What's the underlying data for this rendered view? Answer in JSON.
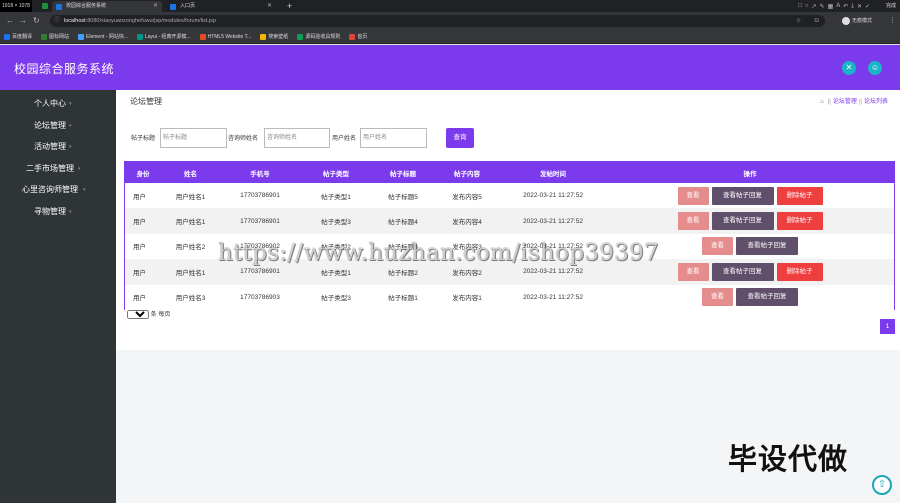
{
  "browser": {
    "window_badge": "1918 × 1078",
    "tabs": [
      {
        "title": "校园综合服务系统",
        "active": true
      },
      {
        "title": "入口页",
        "active": false
      }
    ],
    "new_tab": "+",
    "url_host": "localhost",
    "url_rest": ":8080/xiaoyuanzonghefuwu/jsp/modules/forum/list.jsp",
    "profile_label": "无痕模式",
    "done_label": "完成",
    "bookmarks": [
      "百度翻译",
      "图标网站",
      "Element - 网站快...",
      "Layui - 经典开源模...",
      "HTML5 Website T...",
      "搜索壁纸",
      "源码验收具规则",
      "首页"
    ]
  },
  "app": {
    "title": "校园综合服务系统",
    "header_icons": [
      "shrink-icon",
      "user-icon"
    ]
  },
  "sidebar": {
    "items": [
      {
        "label": "个人中心"
      },
      {
        "label": "论坛管理"
      },
      {
        "label": "活动管理"
      },
      {
        "label": "二手市场管理"
      },
      {
        "label": "心里咨询师管理"
      },
      {
        "label": "寻物管理"
      }
    ]
  },
  "page": {
    "title": "论坛管理",
    "breadcrumb": [
      "论坛管理",
      "论坛列表"
    ]
  },
  "search": {
    "fields": [
      {
        "label": "帖子标题",
        "placeholder": "帖子标题"
      },
      {
        "label": "咨询师姓名",
        "placeholder": "咨询师姓名"
      },
      {
        "label": "用户姓名",
        "placeholder": "用户姓名"
      }
    ],
    "button": "查询"
  },
  "table": {
    "headers": [
      "身份",
      "姓名",
      "手机号",
      "帖子类型",
      "帖子标题",
      "帖子内容",
      "发帖时间",
      "操作"
    ],
    "rows": [
      {
        "role": "用户",
        "name": "用户姓名1",
        "phone": "17703786901",
        "type": "帖子类型1",
        "title": "帖子标题5",
        "content": "发布内容5",
        "time": "2022-03-21 11:27:52",
        "can_delete": true
      },
      {
        "role": "用户",
        "name": "用户姓名1",
        "phone": "17703786901",
        "type": "帖子类型3",
        "title": "帖子标题4",
        "content": "发布内容4",
        "time": "2022-03-21 11:27:52",
        "can_delete": true
      },
      {
        "role": "用户",
        "name": "用户姓名2",
        "phone": "17703786902",
        "type": "帖子类型2",
        "title": "帖子标题3",
        "content": "发布内容3",
        "time": "2022-03-21 11:27:52",
        "can_delete": false
      },
      {
        "role": "用户",
        "name": "用户姓名1",
        "phone": "17703786901",
        "type": "帖子类型1",
        "title": "帖子标题2",
        "content": "发布内容2",
        "time": "2022-03-21 11:27:52",
        "can_delete": true
      },
      {
        "role": "用户",
        "name": "用户姓名3",
        "phone": "17703786903",
        "type": "帖子类型3",
        "title": "帖子标题1",
        "content": "发布内容1",
        "time": "2022-03-21 11:27:52",
        "can_delete": false
      }
    ],
    "actions": {
      "view": "查看",
      "reply": "查看帖子回复",
      "delete": "删除帖子"
    }
  },
  "pagination": {
    "page_size": "10",
    "page_size_suffix": "条 每页",
    "current_page": "1"
  },
  "watermark": "https://www.huzhan.com/ishop39397",
  "overlay_text": "毕设代做",
  "colors": {
    "primary": "#7c3aed",
    "sidebar": "#2f3537",
    "accent_teal": "#19b4c7",
    "btn_view": "#e58d8d",
    "btn_reply": "#5f4f6b",
    "btn_delete": "#ee3e3e"
  }
}
